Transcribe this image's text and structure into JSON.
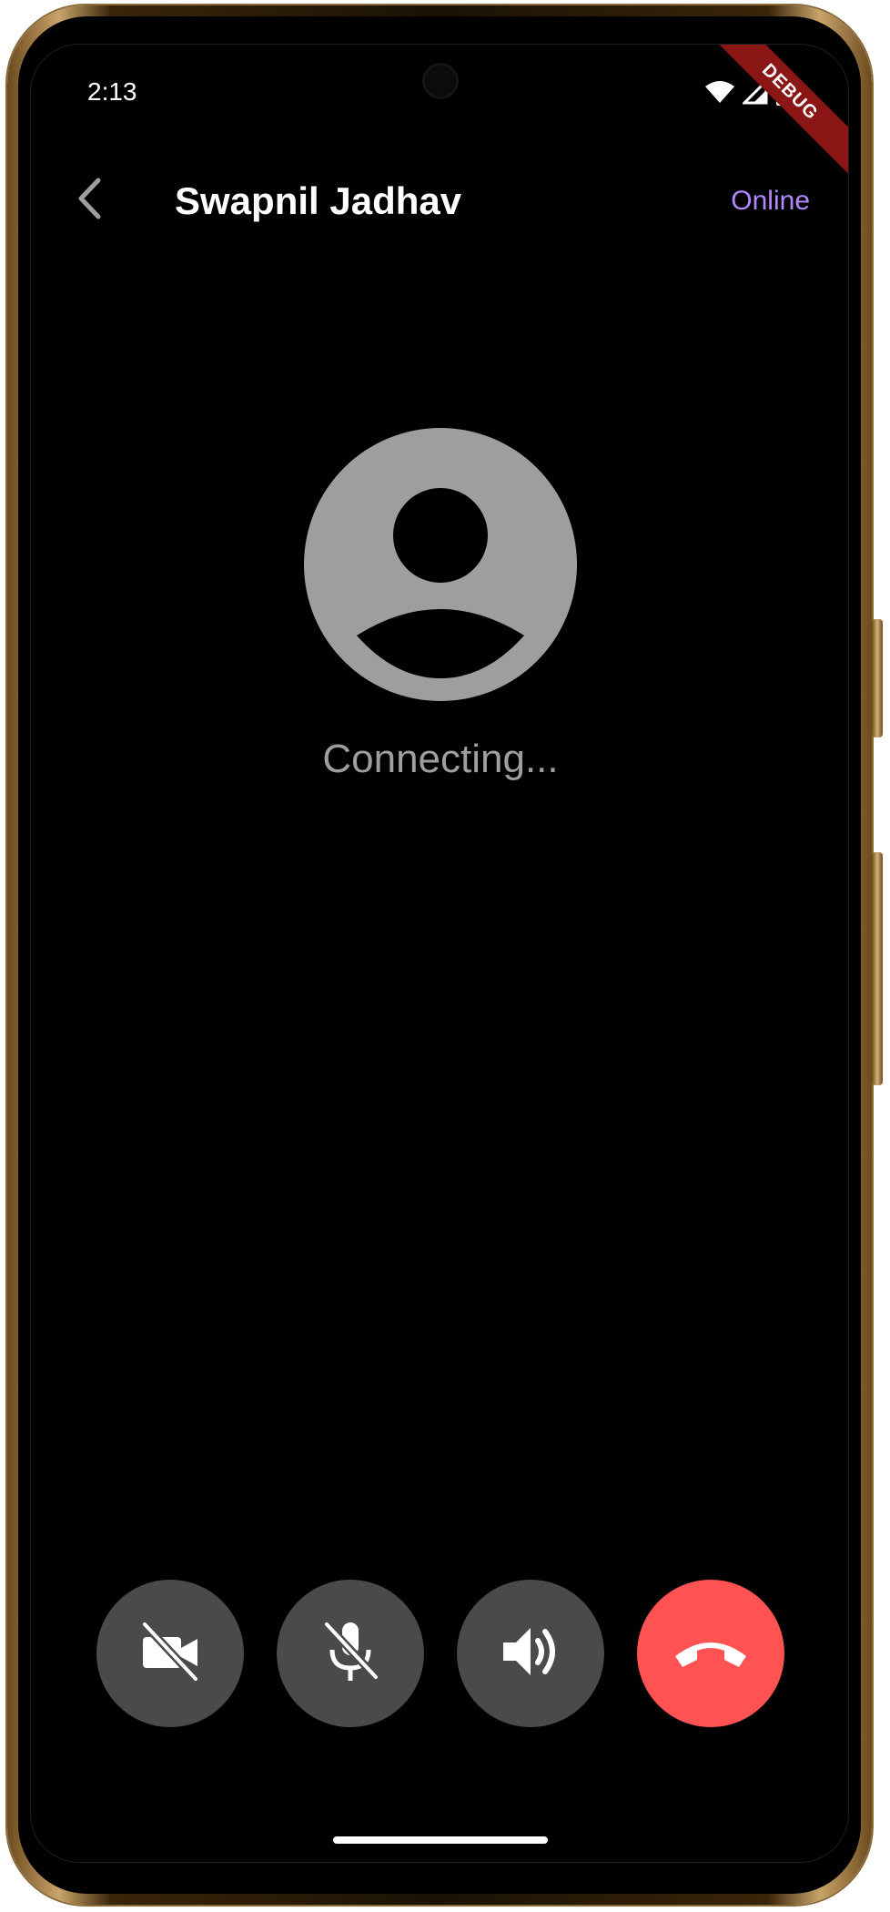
{
  "status_bar": {
    "time": "2:13",
    "icons": [
      "wifi-icon",
      "signal-icon",
      "battery-icon"
    ]
  },
  "debug_banner": "DEBUG",
  "app_bar": {
    "back_icon": "chevron-left-icon",
    "title": "Swapnil Jadhav",
    "status": "Online",
    "status_color": "#b388ff"
  },
  "call": {
    "avatar_icon": "user-avatar-icon",
    "status_text": "Connecting..."
  },
  "controls": [
    {
      "name": "video-off-button",
      "icon": "video-off-icon"
    },
    {
      "name": "mute-button",
      "icon": "mic-off-icon"
    },
    {
      "name": "speaker-button",
      "icon": "volume-up-icon"
    },
    {
      "name": "end-call-button",
      "icon": "call-end-icon",
      "color": "#ff5252"
    }
  ],
  "colors": {
    "background": "#000000",
    "control_bg": "#4a4a4a",
    "avatar": "#9e9e9e"
  }
}
